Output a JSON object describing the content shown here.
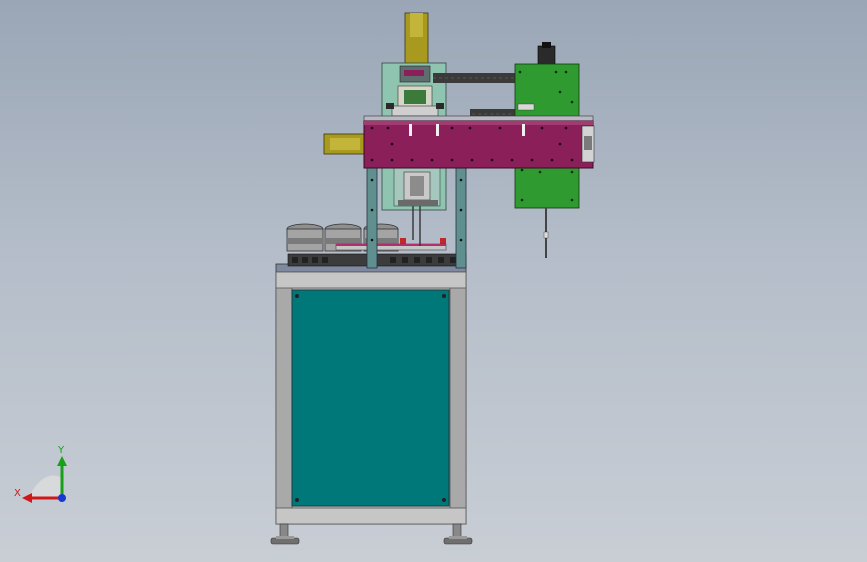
{
  "viewport": {
    "background_top": "#9aa6b6",
    "background_bottom": "#c9ced5"
  },
  "model": {
    "colors": {
      "cabinet_frame": "#b8b8b8",
      "cabinet_frame_dark": "#8c8c8c",
      "cabinet_panel": "#00787a",
      "beam": "#8a1f5a",
      "beam_dark": "#5e1240",
      "green_block": "#2f9a2f",
      "mint_plate": "#8fc4b0",
      "olive_cylinder": "#a89a1e",
      "steel_post": "#5f8f8e",
      "cable_chain": "#3a3a3a",
      "motor": "#2a2a2a",
      "bowl_metal": "#9a9a9a",
      "feet": "#6f6f6f"
    }
  },
  "triad": {
    "x_label": "X",
    "y_label": "Y",
    "x_color": "#d01818",
    "y_color": "#18a018",
    "z_color": "#1838d0"
  }
}
